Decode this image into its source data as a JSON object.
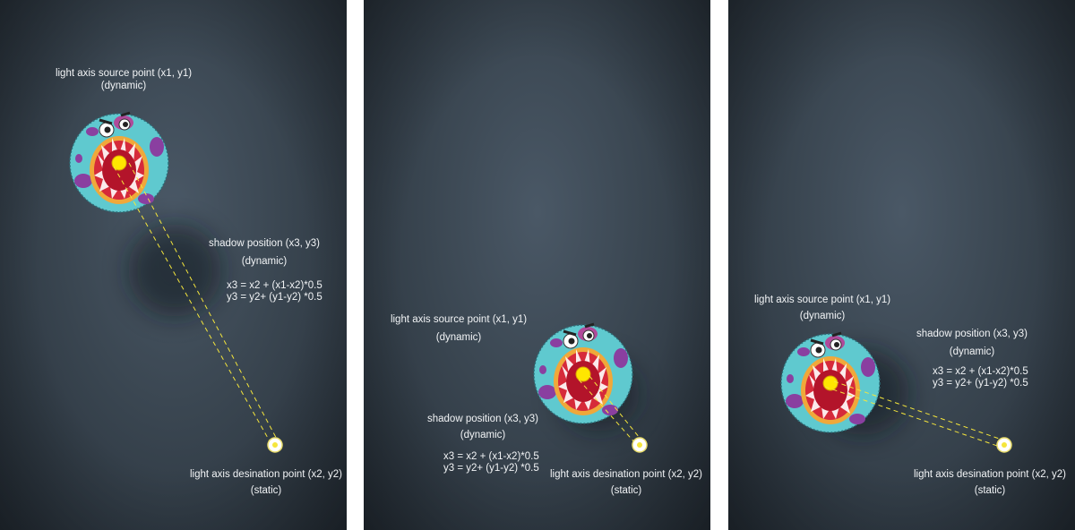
{
  "labels": {
    "source": "light axis source point (x1, y1)",
    "destination": "light axis desination point (x2, y2)",
    "shadow": "shadow position (x3, y3)",
    "dynamic": "(dynamic)",
    "static": "(static)",
    "formula_x": "x3 = x2 + (x1-x2)*0.5",
    "formula_y": "y3 = y2+ (y1-y2) *0.5"
  },
  "colors": {
    "axis_line": "#f5e63c",
    "monster_body": "#5fc9cf",
    "mouth_outer": "#f0a83a",
    "mouth_inner": "#d62a3a",
    "source_point": "#ffe600",
    "destination_point": "#ffffff"
  },
  "icons": [
    "monster-icon",
    "light-source-icon",
    "light-destination-icon",
    "shadow-blob"
  ]
}
